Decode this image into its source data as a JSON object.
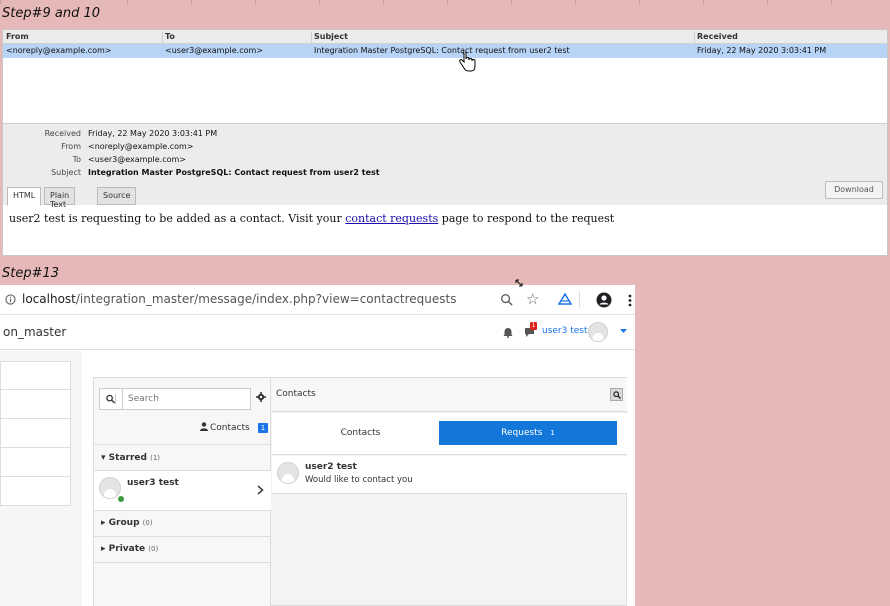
{
  "step_top": "Step#9 and 10",
  "step_bottom": "Step#13",
  "mail": {
    "columns": {
      "from": "From",
      "to": "To",
      "subject": "Subject",
      "received": "Received"
    },
    "row": {
      "from": "<noreply@example.com>",
      "to": "<user3@example.com>",
      "subject": "Integration Master PostgreSQL: Contact request from user2 test",
      "received": "Friday, 22 May 2020 3:03:41 PM"
    },
    "details": {
      "received_label": "Received",
      "received": "Friday, 22 May 2020 3:03:41 PM",
      "from_label": "From",
      "from": "<noreply@example.com>",
      "to_label": "To",
      "to": "<user3@example.com>",
      "subject_label": "Subject",
      "subject": "Integration Master PostgreSQL: Contact request from user2 test"
    },
    "tabs": [
      "HTML",
      "Plain Text",
      "Source"
    ],
    "download_label": "Download",
    "body_pre": "user2 test is requesting to be added as a contact. Visit your ",
    "body_link": "contact requests",
    "body_post": " page to respond to the request"
  },
  "browser": {
    "url_host": "localhost",
    "url_path": "/integration_master/message/index.php?view=contactrequests",
    "app_title": "on_master",
    "user_name": "user3 test",
    "notification_count": "1",
    "search_placeholder": "Search",
    "contacts_link": "Contacts",
    "contacts_badge": "1",
    "starred_label": "Starred",
    "starred_count": "(1)",
    "starred_user": "user3 test",
    "group_label": "Group",
    "group_count": "(0)",
    "private_label": "Private",
    "private_count": "(0)",
    "pane_title": "Contacts",
    "tab_contacts": "Contacts",
    "tab_requests": "Requests",
    "requests_count": "1",
    "request_name": "user2 test",
    "request_text": "Would like to contact you",
    "online_color": "#3c9b3c",
    "accent_color": "#1277d9"
  }
}
